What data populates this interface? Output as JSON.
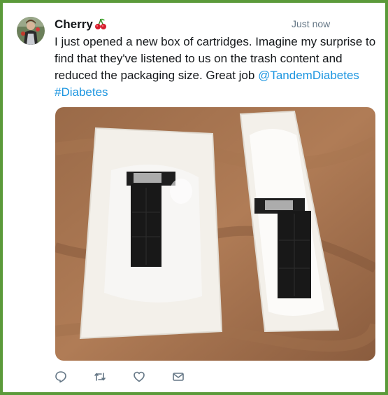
{
  "tweet": {
    "author": "Cherry",
    "timestamp": "Just now",
    "text_main": "I just opened a new box of cartridges. Imagine my surprise to find that they've listened to us on the trash content and reduced the packaging size. Great job ",
    "mention": "@TandemDiabetes",
    "hashtag": "#Diabetes"
  },
  "actions": [
    {
      "icon": "reply-icon"
    },
    {
      "icon": "retweet-icon"
    },
    {
      "icon": "like-icon"
    },
    {
      "icon": "message-icon"
    }
  ],
  "colors": {
    "frame": "#5b9a3a",
    "link": "#1b95e0",
    "icon_gray": "#657786"
  }
}
